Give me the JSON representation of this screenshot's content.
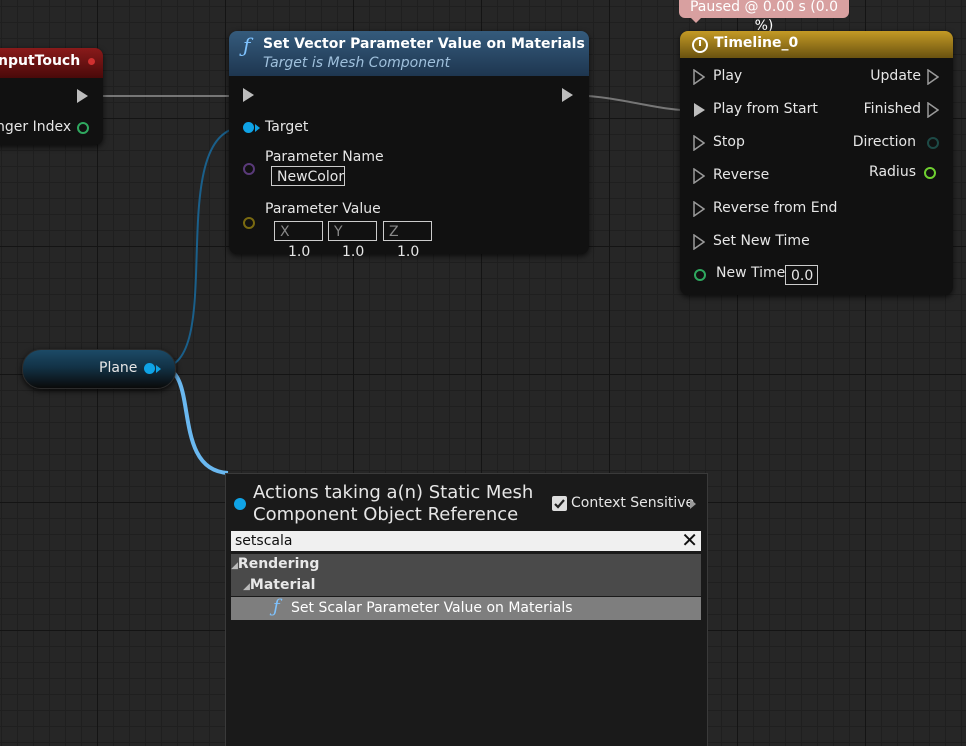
{
  "status_banner": "Paused @ 0.00 s (0.0 %)",
  "input_touch_node": {
    "title": "nputTouch",
    "finger_index_label": "nger Index"
  },
  "vector_node": {
    "title": "Set Vector Parameter Value on Materials",
    "subtitle": "Target is Mesh Component",
    "target_label": "Target",
    "param_name_label": "Parameter Name",
    "param_name_value": "NewColor",
    "param_value_label": "Parameter Value",
    "x_label": "X",
    "x_value": "1.0",
    "y_label": "Y",
    "y_value": "1.0",
    "z_label": "Z",
    "z_value": "1.0"
  },
  "timeline_node": {
    "title": "Timeline_0",
    "inputs": [
      "Play",
      "Play from Start",
      "Stop",
      "Reverse",
      "Reverse from End",
      "Set New Time"
    ],
    "new_time_label": "New Time",
    "new_time_value": "0.0",
    "outputs": [
      "Update",
      "Finished",
      "Direction",
      "Radius"
    ]
  },
  "plane_node": {
    "label": "Plane"
  },
  "action_menu": {
    "title_line1": "Actions taking a(n) Static Mesh",
    "title_line2": "Component Object Reference",
    "context_sensitive_label": "Context Sensitive",
    "context_sensitive_checked": true,
    "search_value": "setscala",
    "category": "Rendering",
    "subcategory": "Material",
    "result": "Set Scalar Parameter Value on Materials"
  },
  "colors": {
    "object_pin": "#0fa3e6",
    "name_pin": "#c9a4f0",
    "struct_pin": "#e6b400",
    "float_pin": "#9ef060",
    "input_node_header": "#7a1010",
    "function_header": "#2d4f6c",
    "timeline_header": "#b08a1c"
  }
}
